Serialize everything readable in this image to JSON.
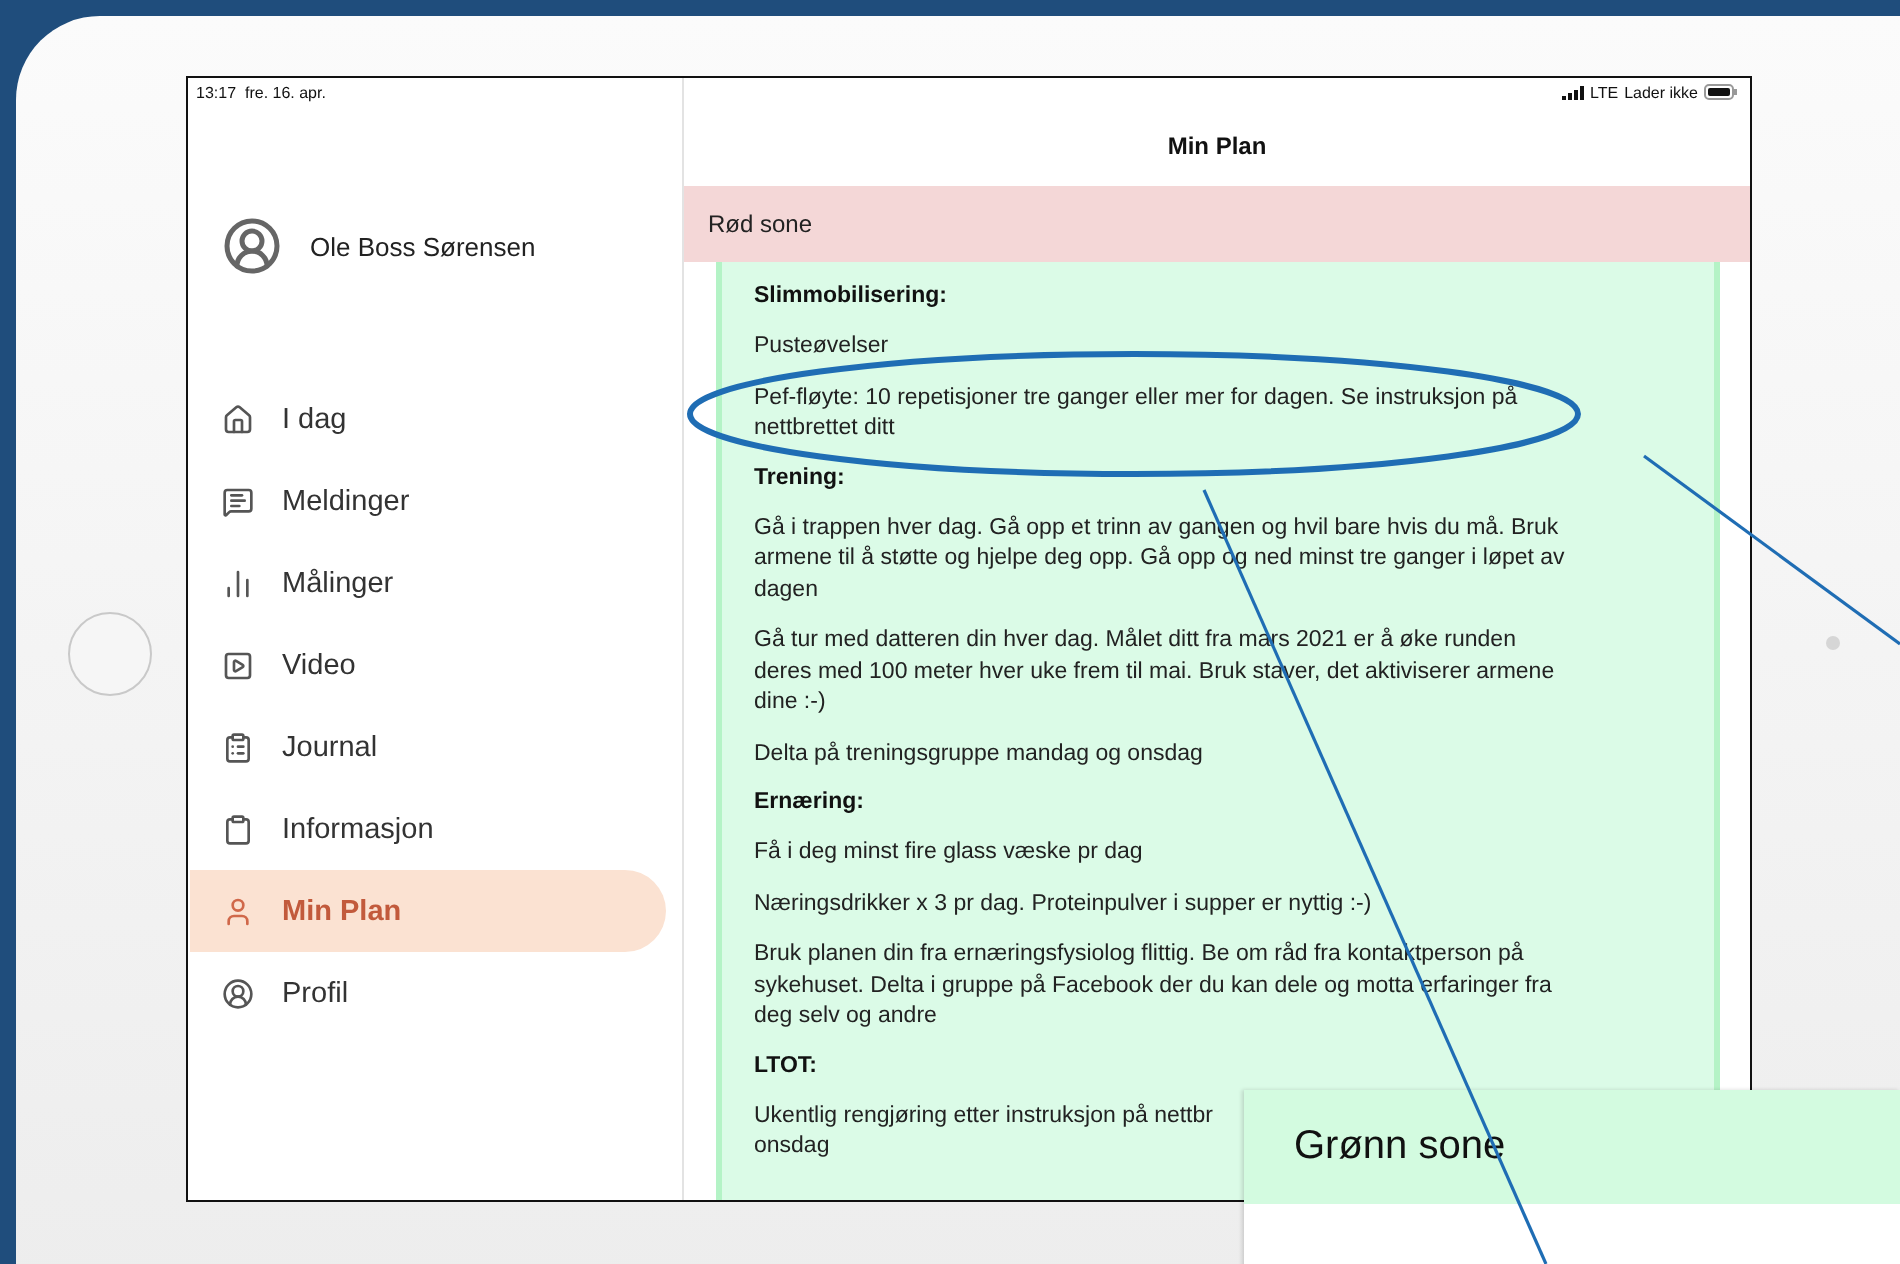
{
  "status_bar": {
    "time": "13:17",
    "date": "fre. 16. apr.",
    "network": "LTE",
    "charging": "Lader ikke"
  },
  "profile": {
    "name": "Ole Boss Sørensen"
  },
  "nav": [
    {
      "label": "I dag",
      "selected": false
    },
    {
      "label": "Meldinger",
      "selected": false
    },
    {
      "label": "Målinger",
      "selected": false
    },
    {
      "label": "Video",
      "selected": false
    },
    {
      "label": "Journal",
      "selected": false
    },
    {
      "label": "Informasjon",
      "selected": false
    },
    {
      "label": "Min Plan",
      "selected": true
    },
    {
      "label": "Profil",
      "selected": false
    }
  ],
  "header": {
    "title": "Min Plan"
  },
  "zone_bar": {
    "label": "Rød sone"
  },
  "plan": [
    {
      "kind": "heading",
      "text": "Slimmobilisering:"
    },
    {
      "kind": "paragraph",
      "lines": [
        "Pusteøvelser"
      ]
    },
    {
      "kind": "paragraph",
      "lines": [
        "Pef-fløyte: 10 repetisjoner tre ganger eller mer for dagen. Se instruksjon på nettbrettet ditt"
      ]
    },
    {
      "kind": "heading",
      "text": "Trening:"
    },
    {
      "kind": "paragraph",
      "lines": [
        "Gå i trappen hver dag. Gå opp et trinn av gangen og hvil bare hvis du må. Bruk armene til å støtte og hjelpe deg opp. Gå opp og ned minst tre ganger i løpet av dagen"
      ]
    },
    {
      "kind": "paragraph",
      "lines": [
        "Gå tur med datteren din hver dag. Målet ditt fra mars 2021 er å øke runden deres med 100 meter hver uke frem til mai. Bruk staver, det aktiviserer armene dine :-)"
      ]
    },
    {
      "kind": "paragraph",
      "lines": [
        "Delta på treningsgruppe mandag og onsdag"
      ]
    },
    {
      "kind": "heading",
      "text": "Ernæring:"
    },
    {
      "kind": "paragraph",
      "lines": [
        "Få i deg minst fire glass væske pr dag"
      ]
    },
    {
      "kind": "paragraph",
      "lines": [
        "Næringsdrikker x 3 pr dag. Proteinpulver i supper er nyttig :-)"
      ]
    },
    {
      "kind": "paragraph",
      "lines": [
        "Bruk planen din fra ernæringsfysiolog flittig. Be om råd fra kontaktperson på sykehuset. Delta i gruppe på Facebook der du kan dele og motta erfaringer fra deg selv og andre"
      ]
    },
    {
      "kind": "heading",
      "text": "LTOT:"
    },
    {
      "kind": "paragraph",
      "lines": [
        "Ukentlig rengjøring etter instruksjon på nettbr",
        "onsdag"
      ]
    }
  ],
  "overlay_panel": {
    "title": "Grønn sone"
  }
}
